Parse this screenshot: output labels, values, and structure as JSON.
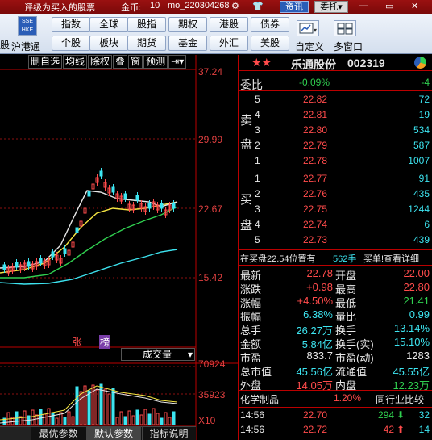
{
  "titlebar": {
    "caption": "评级为买入的股票",
    "coin_label": "金币:",
    "coin_value": "10",
    "account": "mo_220304268",
    "info_btn": "资讯",
    "trade_btn": "委托"
  },
  "toolbar": {
    "left_small": "股",
    "hk_connect": "沪港通",
    "row1": [
      "指数",
      "全球",
      "股指",
      "期权",
      "港股",
      "债券"
    ],
    "row2": [
      "个股",
      "板块",
      "期货",
      "基金",
      "外汇",
      "美股"
    ],
    "custom": "自定义",
    "multi_window": "多窗口"
  },
  "chart_tabs": [
    "删自选",
    "均线",
    "除权",
    "叠",
    "窗",
    "预测"
  ],
  "price_axis": [
    "37.24",
    "29.99",
    "22.67",
    "15.42"
  ],
  "volume_axis": [
    "70924",
    "35923",
    "X10"
  ],
  "markers": {
    "zhang": "张",
    "bang": "榜"
  },
  "volume_selector": "成交量",
  "bottom_tabs": [
    "最优参数",
    "默认参数",
    "指标说明"
  ],
  "stock": {
    "name": "乐通股份",
    "code": "002319",
    "weibi_label": "委比",
    "weibi_pct": "-0.09%",
    "weibi_diff": "-4",
    "sell": [
      {
        "lvl": "5",
        "price": "22.82",
        "vol": "72"
      },
      {
        "lvl": "4",
        "price": "22.81",
        "vol": "19"
      },
      {
        "lvl": "3",
        "price": "22.80",
        "vol": "534"
      },
      {
        "lvl": "2",
        "price": "22.79",
        "vol": "587"
      },
      {
        "lvl": "1",
        "price": "22.78",
        "vol": "1007"
      }
    ],
    "sell_label": [
      "卖",
      "盘"
    ],
    "buy": [
      {
        "lvl": "1",
        "price": "22.77",
        "vol": "91"
      },
      {
        "lvl": "2",
        "price": "22.76",
        "vol": "435"
      },
      {
        "lvl": "3",
        "price": "22.75",
        "vol": "1244"
      },
      {
        "lvl": "4",
        "price": "22.74",
        "vol": "6"
      },
      {
        "lvl": "5",
        "price": "22.73",
        "vol": "439"
      }
    ],
    "buy_label": [
      "买",
      "盘"
    ],
    "in_buy_note": "在买盘22.54位置有",
    "in_buy_qty": "562手",
    "in_buy_link": "买单!查看详细",
    "stats": [
      {
        "l1": "最新",
        "v1": "22.78",
        "c1": "red",
        "l2": "开盘",
        "v2": "22.00",
        "c2": "red"
      },
      {
        "l1": "涨跌",
        "v1": "+0.98",
        "c1": "red",
        "l2": "最高",
        "v2": "22.80",
        "c2": "red"
      },
      {
        "l1": "涨幅",
        "v1": "+4.50%",
        "c1": "red",
        "l2": "最低",
        "v2": "21.41",
        "c2": "green"
      },
      {
        "l1": "振幅",
        "v1": "6.38%",
        "c1": "cyan",
        "l2": "量比",
        "v2": "0.99",
        "c2": "cyan"
      },
      {
        "l1": "总手",
        "v1": "26.27万",
        "c1": "cyan",
        "l2": "换手",
        "v2": "13.14%",
        "c2": "cyan"
      },
      {
        "l1": "金额",
        "v1": "5.84亿",
        "c1": "cyan",
        "l2": "换手(实)",
        "v2": "15.10%",
        "c2": "cyan"
      },
      {
        "l1": "市盈",
        "v1": "833.7",
        "c1": "white",
        "l2": "市盈(动)",
        "v2": "1283",
        "c2": "white"
      },
      {
        "l1": "总市值",
        "v1": "45.56亿",
        "c1": "cyan",
        "l2": "流通值",
        "v2": "45.55亿",
        "c2": "cyan"
      },
      {
        "l1": "外盘",
        "v1": "14.05万",
        "c1": "red",
        "l2": "内盘",
        "v2": "12.23万",
        "c2": "green"
      }
    ],
    "industry": "化学制品",
    "industry_pct": "1.20%",
    "industry_btn": "同行业比较",
    "ticks": [
      {
        "time": "14:56",
        "price": "22.70",
        "vol": "294",
        "dir": "down",
        "n": "32"
      },
      {
        "time": "14:56",
        "price": "22.72",
        "vol": "42",
        "dir": "up",
        "n": "14"
      }
    ]
  },
  "colors": {
    "up": "#ff4b4b",
    "down": "#30d050",
    "accent": "#3de4f0"
  }
}
